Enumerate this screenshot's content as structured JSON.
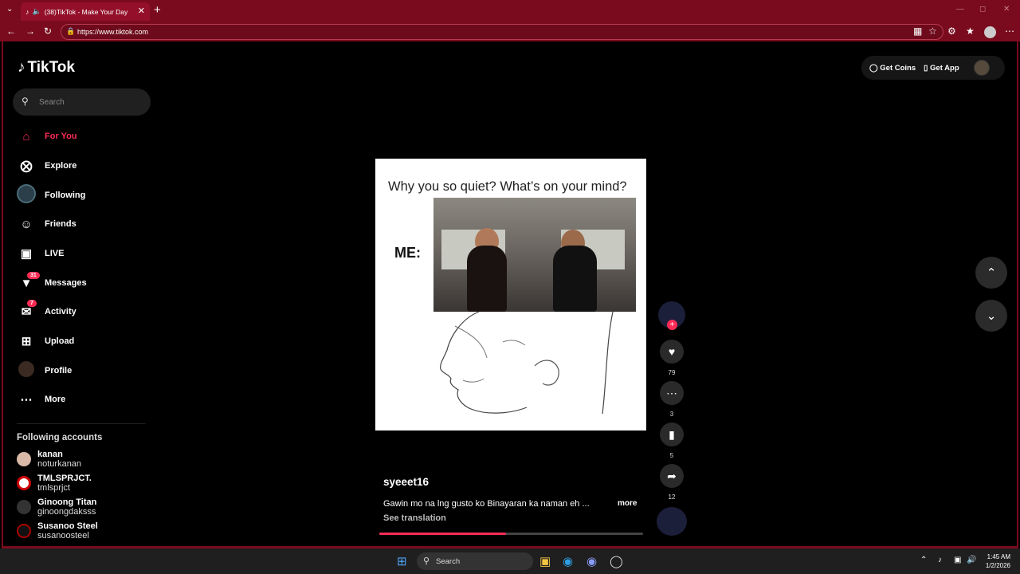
{
  "browser": {
    "tab_title": "(38)TikTok - Make Your Day",
    "url": "https://www.tiktok.com"
  },
  "app": {
    "logo_text": "TikTok",
    "search_placeholder": "Search",
    "nav": [
      {
        "label": "For You",
        "icon": "home-icon",
        "active": true
      },
      {
        "label": "Explore",
        "icon": "compass-icon"
      },
      {
        "label": "Following",
        "icon": "following-avatar"
      },
      {
        "label": "Friends",
        "icon": "friends-icon"
      },
      {
        "label": "LIVE",
        "icon": "live-icon"
      },
      {
        "label": "Messages",
        "icon": "messages-icon",
        "badge": "31"
      },
      {
        "label": "Activity",
        "icon": "activity-icon",
        "badge": "7"
      },
      {
        "label": "Upload",
        "icon": "upload-icon"
      },
      {
        "label": "Profile",
        "icon": "profile-avatar"
      },
      {
        "label": "More",
        "icon": "more-icon"
      }
    ],
    "following_title": "Following accounts",
    "following_accounts": [
      {
        "name": "kanan",
        "username": "noturkanan"
      },
      {
        "name": "TMLSPRJCT.",
        "username": "tmlsprjct"
      },
      {
        "name": "Ginoong Titan",
        "username": "ginoongdaksss"
      },
      {
        "name": "Susanoo Steel",
        "username": "susanoosteel"
      }
    ],
    "get_coins": "Get Coins",
    "get_app": "Get App"
  },
  "video": {
    "overlay_text": "Why you so quiet? What’s on your mind?",
    "me_label": "ME:",
    "username": "syeeet16",
    "caption": "Gawin mo na lng gusto ko Binayaran ka naman eh ...",
    "more_label": "more",
    "translate_label": "See translation",
    "progress_fraction": 0.48,
    "likes": "79",
    "comments": "3",
    "saves": "5",
    "shares": "12"
  },
  "taskbar": {
    "search_label": "Search",
    "time": "1:45 AM",
    "date": "1/2/2026"
  },
  "colors": {
    "accent": "#fe2c55",
    "browser_frame": "#7a0b1e"
  }
}
